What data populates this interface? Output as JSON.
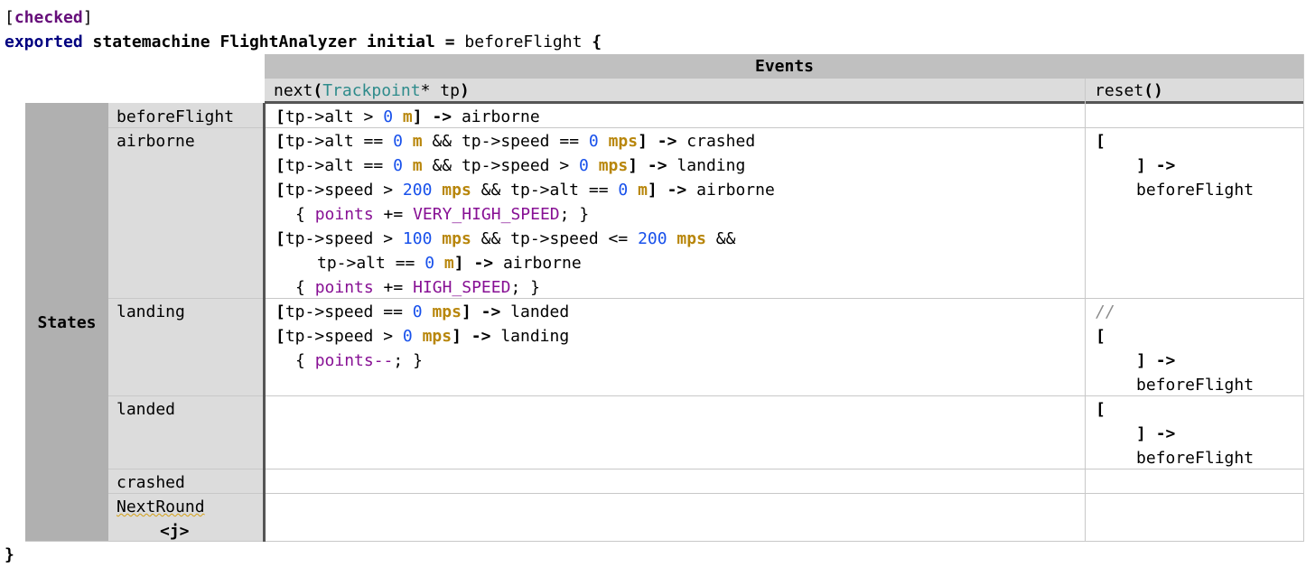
{
  "annotation": "checked",
  "header": {
    "exported": "exported",
    "statemachine": "statemachine",
    "name": "FlightAnalyzer",
    "initial": "initial",
    "equals": "=",
    "initial_state": "beforeFlight",
    "brace_open": "{"
  },
  "closing_brace": "}",
  "table": {
    "events_label": "Events",
    "states_label": "States",
    "event_next": {
      "name": "next",
      "type": "Trackpoint",
      "param": "* tp"
    },
    "event_reset": {
      "name": "reset"
    },
    "states": [
      "beforeFlight",
      "airborne",
      "landing",
      "landed",
      "crashed",
      "NextRound",
      "<j>"
    ]
  },
  "transitions": {
    "beforeFlight": {
      "target": "airborne"
    },
    "airborne": [
      {
        "target": "crashed"
      },
      {
        "target": "landing"
      },
      {
        "target": "airborne",
        "action_var": "points",
        "action_value": "VERY_HIGH_SPEED"
      },
      {
        "target": "airborne",
        "action_var": "points",
        "action_value": "HIGH_SPEED"
      }
    ],
    "landing": [
      {
        "target": "landed"
      },
      {
        "target": "landing",
        "action": "points--"
      }
    ],
    "reset_target": "beforeFlight",
    "reset_comment": "//"
  },
  "code": {
    "tp_alt": "tp->alt",
    "tp_speed": "tp->speed",
    "arrow": "->",
    "and": "&&",
    "unit_m": "m",
    "unit_mps": "mps",
    "zero": "0",
    "v100": "100",
    "v200": "200"
  }
}
